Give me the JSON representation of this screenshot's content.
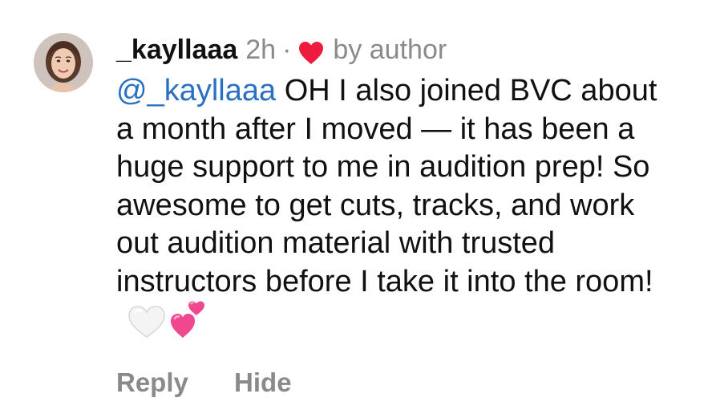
{
  "comment": {
    "username": "_kayllaaa",
    "time": "2h",
    "separator": "·",
    "liked_by_author_label": "by author",
    "mention": "@_kayllaaa",
    "text": " OH I also joined BVC about a month after I moved — it has been a huge support to me in audition prep! So awesome to get cuts, tracks, and work out audition material with trusted instructors before I take it into the room!",
    "emojis": [
      "white-heart-icon",
      "two-hearts-icon"
    ]
  },
  "actions": {
    "reply_label": "Reply",
    "hide_label": "Hide"
  },
  "colors": {
    "mention": "#2a71c4",
    "muted": "#8a8a8a",
    "like_heart": "#ed1c3f",
    "pink_hearts": "#f0478f"
  }
}
